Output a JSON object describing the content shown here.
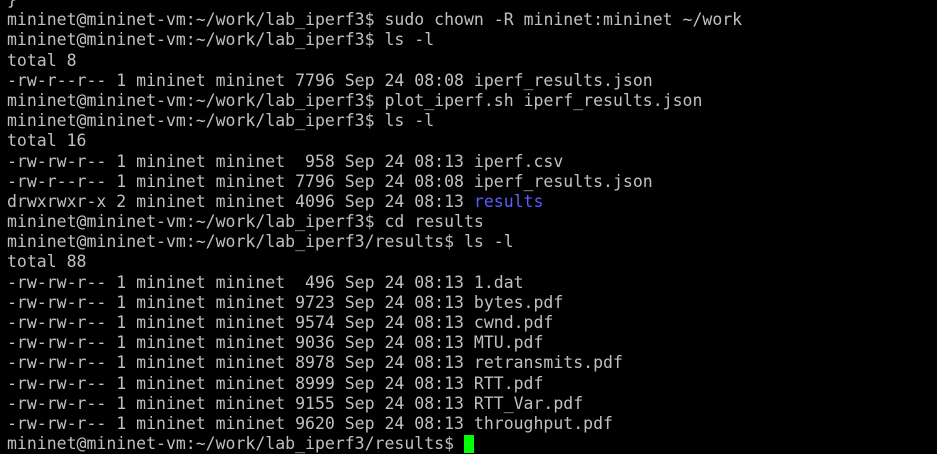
{
  "terminal": {
    "prompt_home": "mininet@mininet-vm:~/work/lab_iperf3$",
    "prompt_results": "mininet@mininet-vm:~/work/lab_iperf3/results$",
    "colors": {
      "background": "#000000",
      "text": "#c0c0c0",
      "directory": "#5c5cff",
      "cursor": "#00ff00"
    },
    "partial_top_line": "}",
    "cmd_chown": " sudo chown -R mininet:mininet ~/work",
    "cmd_ls1": " ls -l",
    "total1": "total 8",
    "ls1_row1": "-rw-r--r-- 1 mininet mininet 7796 Sep 24 08:08 iperf_results.json",
    "cmd_plot": " plot_iperf.sh iperf_results.json",
    "cmd_ls2": " ls -l",
    "total2": "total 16",
    "ls2_row1": "-rw-rw-r-- 1 mininet mininet  958 Sep 24 08:13 iperf.csv",
    "ls2_row2": "-rw-r--r-- 1 mininet mininet 7796 Sep 24 08:08 iperf_results.json",
    "ls2_row3_prefix": "drwxrwxr-x 2 mininet mininet 4096 Sep 24 08:13 ",
    "ls2_row3_dir": "results",
    "cmd_cd": " cd results",
    "cmd_ls3": " ls -l",
    "total3": "total 88",
    "ls3_rows": [
      "-rw-rw-r-- 1 mininet mininet  496 Sep 24 08:13 1.dat",
      "-rw-rw-r-- 1 mininet mininet 9723 Sep 24 08:13 bytes.pdf",
      "-rw-rw-r-- 1 mininet mininet 9574 Sep 24 08:13 cwnd.pdf",
      "-rw-rw-r-- 1 mininet mininet 9036 Sep 24 08:13 MTU.pdf",
      "-rw-rw-r-- 1 mininet mininet 8978 Sep 24 08:13 retransmits.pdf",
      "-rw-rw-r-- 1 mininet mininet 8999 Sep 24 08:13 RTT.pdf",
      "-rw-rw-r-- 1 mininet mininet 9155 Sep 24 08:13 RTT_Var.pdf",
      "-rw-rw-r-- 1 mininet mininet 9620 Sep 24 08:13 throughput.pdf"
    ],
    "final_input": " "
  }
}
